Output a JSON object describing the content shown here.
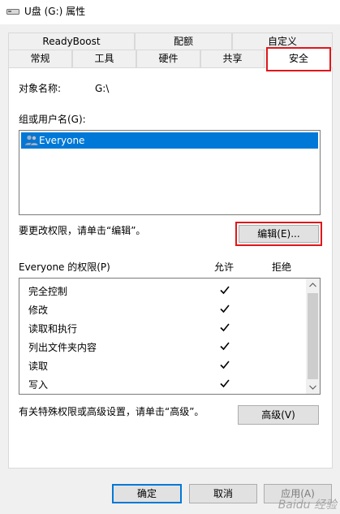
{
  "window": {
    "title": "U盘 (G:) 属性",
    "icon": "drive-icon"
  },
  "tabs": {
    "row1": [
      "ReadyBoost",
      "配额",
      "自定义"
    ],
    "row2": [
      "常规",
      "工具",
      "硬件",
      "共享",
      "安全"
    ],
    "active": "安全"
  },
  "security": {
    "object_label": "对象名称:",
    "object_value": "G:\\",
    "group_label": "组或用户名(G):",
    "users": [
      {
        "name": "Everyone",
        "icon": "users-icon",
        "selected": true
      }
    ],
    "change_text": "要更改权限，请单击“编辑”。",
    "edit_button": "编辑(E)...",
    "permissions_label": "Everyone 的权限(P)",
    "allow_header": "允许",
    "deny_header": "拒绝",
    "permissions": [
      {
        "name": "完全控制",
        "allow": true,
        "deny": false
      },
      {
        "name": "修改",
        "allow": true,
        "deny": false
      },
      {
        "name": "读取和执行",
        "allow": true,
        "deny": false
      },
      {
        "name": "列出文件夹内容",
        "allow": true,
        "deny": false
      },
      {
        "name": "读取",
        "allow": true,
        "deny": false
      },
      {
        "name": "写入",
        "allow": true,
        "deny": false
      }
    ],
    "advanced_text": "有关特殊权限或高级设置，请单击“高级”。",
    "advanced_button": "高级(V)"
  },
  "footer": {
    "ok": "确定",
    "cancel": "取消",
    "apply": "应用(A)"
  },
  "watermark": "Baidu 经验",
  "colors": {
    "highlight": "#0078d7",
    "annotation_red": "#e0171b"
  }
}
